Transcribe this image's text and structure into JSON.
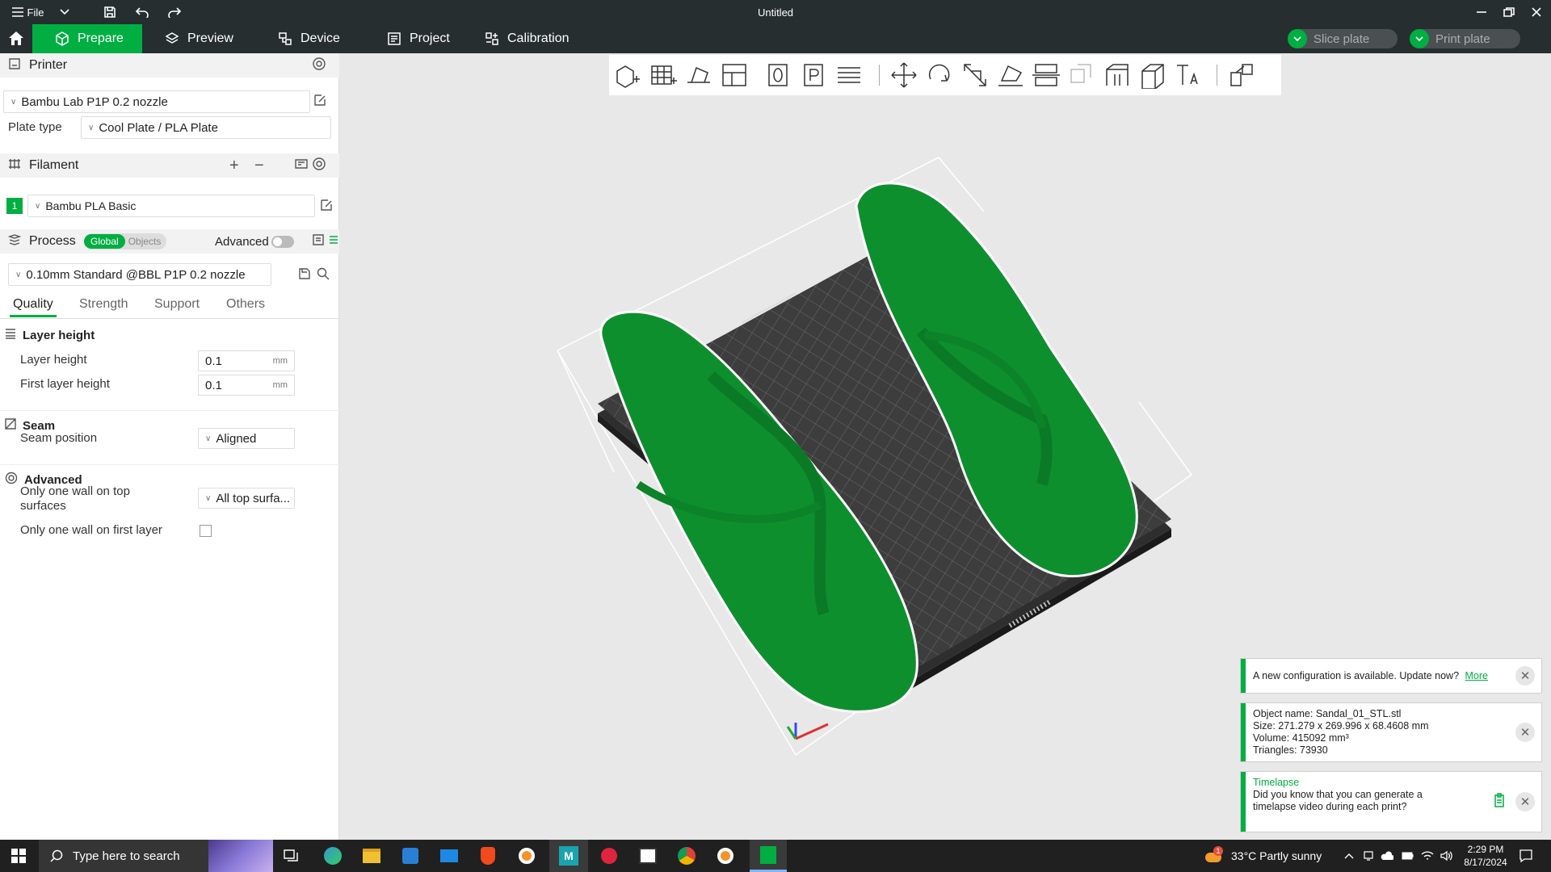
{
  "window": {
    "file_menu": "File",
    "title": "Untitled"
  },
  "tabs": [
    {
      "label": "Prepare"
    },
    {
      "label": "Preview"
    },
    {
      "label": "Device"
    },
    {
      "label": "Project"
    },
    {
      "label": "Calibration"
    }
  ],
  "actions": {
    "slice": "Slice plate",
    "print": "Print plate"
  },
  "printer": {
    "heading": "Printer",
    "selected": "Bambu Lab P1P 0.2 nozzle",
    "plate_type_label": "Plate type",
    "plate_type": "Cool Plate / PLA Plate"
  },
  "filament": {
    "heading": "Filament",
    "slot": "1",
    "selected": "Bambu PLA Basic"
  },
  "process": {
    "heading": "Process",
    "toggle_global": "Global",
    "toggle_objects": "Objects",
    "advanced_label": "Advanced",
    "preset": "0.10mm Standard @BBL P1P 0.2 nozzle",
    "tabs": [
      "Quality",
      "Strength",
      "Support",
      "Others"
    ],
    "groups": {
      "layer_height": {
        "title": "Layer height",
        "layer_height_label": "Layer height",
        "layer_height_value": "0.1",
        "first_layer_label": "First layer height",
        "first_layer_value": "0.1",
        "unit": "mm"
      },
      "seam": {
        "title": "Seam",
        "position_label": "Seam position",
        "position_value": "Aligned"
      },
      "advanced": {
        "title": "Advanced",
        "top_wall_label_1": "Only one wall on top",
        "top_wall_label_2": "surfaces",
        "top_wall_value": "All top surfa...",
        "first_layer_wall_label": "Only one wall on first layer",
        "first_layer_wall_checked": false
      }
    }
  },
  "notifications": {
    "config": {
      "text": "A new configuration is available. Update now?",
      "link": "More"
    },
    "object": {
      "name": "Object name: Sandal_01_STL.stl",
      "size": "Size: 271.279 x 269.996 x 68.4608 mm",
      "volume": "Volume: 415092 mm³",
      "triangles": "Triangles: 73930"
    },
    "timelapse": {
      "title": "Timelapse",
      "line1": "Did you know that you can generate a",
      "line2": "timelapse video during each print?"
    }
  },
  "taskbar": {
    "search_placeholder": "Type here to search",
    "weather": "33°C  Partly sunny",
    "weather_badge": "1",
    "time": "2:29 PM",
    "date": "8/17/2024"
  },
  "colors": {
    "accent": "#00ae42",
    "titlebar": "#262e30",
    "model": "#0e8f2e"
  }
}
